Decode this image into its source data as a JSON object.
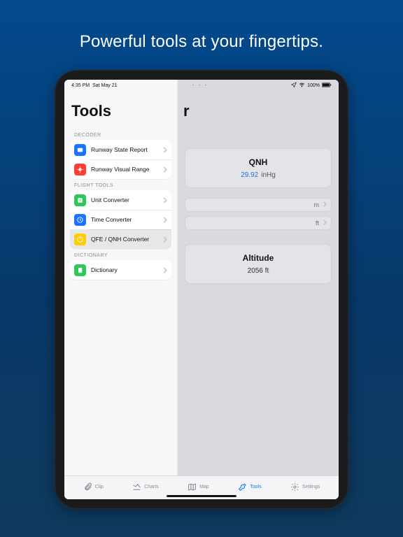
{
  "marketing": {
    "tagline": "Powerful tools at your fingertips."
  },
  "statusbar": {
    "time": "4:35 PM",
    "date": "Sat May 21",
    "batteryText": "100%"
  },
  "sidebar": {
    "title": "Tools",
    "sections": {
      "decoder": {
        "label": "DECODER",
        "items": [
          "Runway State Report",
          "Runway Visual Range"
        ]
      },
      "flightTools": {
        "label": "FLIGHT TOOLS",
        "items": [
          "Unit Converter",
          "Time Converter",
          "QFE / QNH Converter"
        ]
      },
      "dictionary": {
        "label": "DICTIONARY",
        "items": [
          "Dictionary"
        ]
      }
    }
  },
  "main": {
    "titleVisibleFragment": "r",
    "qnh": {
      "title": "QNH",
      "value": "29.92",
      "unit": "inHg"
    },
    "unitRows": {
      "m": "m",
      "ft": "ft"
    },
    "altitude": {
      "title": "Altitude",
      "value": "2056 ft"
    }
  },
  "tabbar": {
    "clip": "Clip",
    "charts": "Charts",
    "map": "Map",
    "tools": "Tools",
    "settings": "Settings"
  },
  "colors": {
    "iconBlue": "#1b74ff",
    "iconRed": "#ff3d34",
    "iconGreen": "#2ec759",
    "iconYellow": "#ffcc00",
    "accent": "#0a7aff"
  }
}
